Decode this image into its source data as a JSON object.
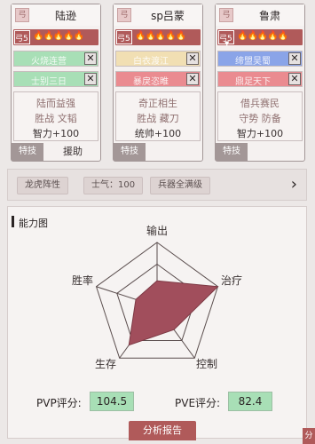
{
  "heroes": [
    {
      "badge": "弓",
      "name": "陆逊",
      "level": "弓5",
      "stars": "🔥🔥🔥🔥🔥",
      "skills": [
        {
          "text": "火烧连营",
          "color": "green"
        },
        {
          "text": "士别三日",
          "color": "green"
        }
      ],
      "info": [
        "陆而益强",
        "胜战 文韬",
        "智力+100"
      ],
      "tabs": [
        "特技",
        "援助"
      ]
    },
    {
      "badge": "弓",
      "name": "sp吕蒙",
      "level": "弓5",
      "stars": "🔥🔥🔥🔥🔥",
      "skills": [
        {
          "text": "白衣渡江",
          "color": "yellow"
        },
        {
          "text": "暴戾恣睢",
          "color": "pink"
        }
      ],
      "info": [
        "奇正相生",
        "胜战 藏刀",
        "统帅+100"
      ],
      "tabs": [
        "特技"
      ]
    },
    {
      "badge": "弓",
      "name": "鲁肃",
      "level": "弓5",
      "stars": "🔥🔥🔥🔥🔥",
      "skills": [
        {
          "text": "缔盟吴蜀",
          "color": "blue"
        },
        {
          "text": "鼎足天下",
          "color": "pink"
        }
      ],
      "info": [
        "借兵赛民",
        "守势 防备",
        "智力+100"
      ],
      "tabs": [
        "特技"
      ]
    }
  ],
  "buffs": {
    "chips": [
      "龙虎阵性",
      "士气：100",
      "兵器全满级"
    ],
    "arrow": "›"
  },
  "ability": {
    "title": "能力图",
    "axes": [
      "输出",
      "治疗",
      "控制",
      "生存",
      "胜率"
    ],
    "values": [
      0.4,
      1.0,
      0.45,
      0.75,
      0.35
    ],
    "pvp_label": "PVP评分:",
    "pvp_value": "104.5",
    "pve_label": "PVE评分:",
    "pve_value": "82.4",
    "report_button": "分析报告"
  },
  "share_button": "分",
  "colors": {
    "accent": "#b05a5a",
    "radar_fill": "#a14e5c",
    "score_bg": "#a8dfb6"
  }
}
